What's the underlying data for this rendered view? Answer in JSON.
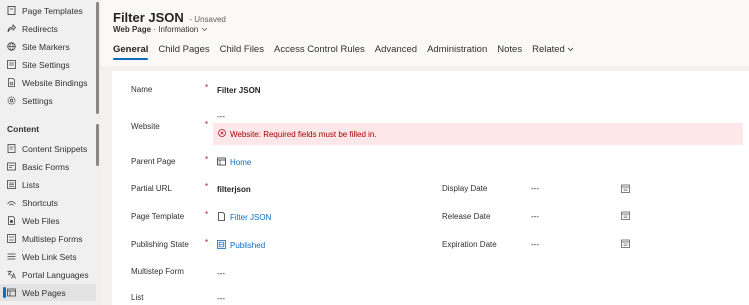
{
  "sidebar": {
    "items": [
      {
        "label": "Page Templates",
        "icon": "page-template-icon"
      },
      {
        "label": "Redirects",
        "icon": "redirect-icon"
      },
      {
        "label": "Site Markers",
        "icon": "globe-icon"
      },
      {
        "label": "Site Settings",
        "icon": "settings-list-icon"
      },
      {
        "label": "Website Bindings",
        "icon": "binding-icon"
      },
      {
        "label": "Settings",
        "icon": "gear-icon"
      }
    ],
    "section_title": "Content",
    "content_items": [
      {
        "label": "Content Snippets",
        "icon": "snippet-icon"
      },
      {
        "label": "Basic Forms",
        "icon": "form-icon"
      },
      {
        "label": "Lists",
        "icon": "list-icon"
      },
      {
        "label": "Shortcuts",
        "icon": "shortcut-icon"
      },
      {
        "label": "Web Files",
        "icon": "file-icon"
      },
      {
        "label": "Multistep Forms",
        "icon": "multistep-icon"
      },
      {
        "label": "Web Link Sets",
        "icon": "link-set-icon"
      },
      {
        "label": "Portal Languages",
        "icon": "language-icon"
      },
      {
        "label": "Web Pages",
        "icon": "web-page-icon"
      }
    ],
    "active_label": "Web Pages"
  },
  "header": {
    "title": "Filter JSON",
    "status": "- Unsaved",
    "entity": "Web Page",
    "separator": "·",
    "form_name": "Information",
    "tabs": [
      "General",
      "Child Pages",
      "Child Files",
      "Access Control Rules",
      "Advanced",
      "Administration",
      "Notes",
      "Related"
    ],
    "active_tab": "General"
  },
  "form": {
    "name_label": "Name",
    "name_value": "Filter JSON",
    "website_label": "Website",
    "website_value": "---",
    "website_error": "Website: Required fields must be filled in.",
    "parent_label": "Parent Page",
    "parent_value": "Home",
    "partial_label": "Partial URL",
    "partial_value": "filterjson",
    "template_label": "Page Template",
    "template_value": "Filter JSON",
    "publishing_label": "Publishing State",
    "publishing_value": "Published",
    "multistep_label": "Multistep Form",
    "multistep_value": "---",
    "list_label": "List",
    "list_value": "---",
    "display_date_label": "Display Date",
    "display_date_value": "---",
    "release_date_label": "Release Date",
    "release_date_value": "---",
    "expiration_date_label": "Expiration Date",
    "expiration_date_value": "---",
    "required_marker": "*"
  }
}
